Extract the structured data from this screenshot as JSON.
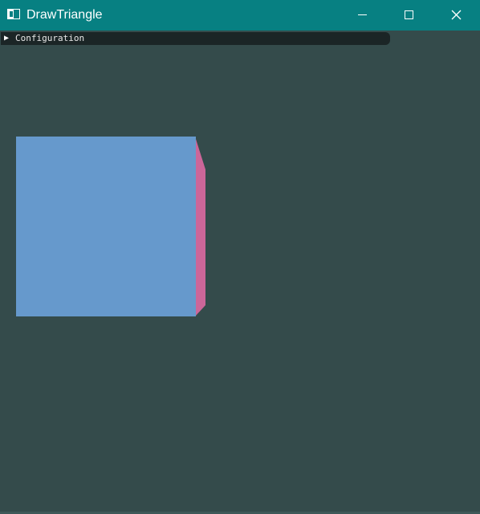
{
  "window": {
    "title": "DrawTriangle",
    "icon": "app-window-icon",
    "controls": {
      "minimize_icon": "minimize-icon",
      "maximize_icon": "maximize-icon",
      "close_icon": "close-icon"
    },
    "colors": {
      "titlebar": "#078082",
      "background": "#344b4b"
    }
  },
  "config_panel": {
    "arrow": "▶",
    "label": "Configuration",
    "state": "collapsed"
  },
  "scene": {
    "colors": {
      "front_face": "#6699cc",
      "side_face": "#cc6699"
    }
  }
}
